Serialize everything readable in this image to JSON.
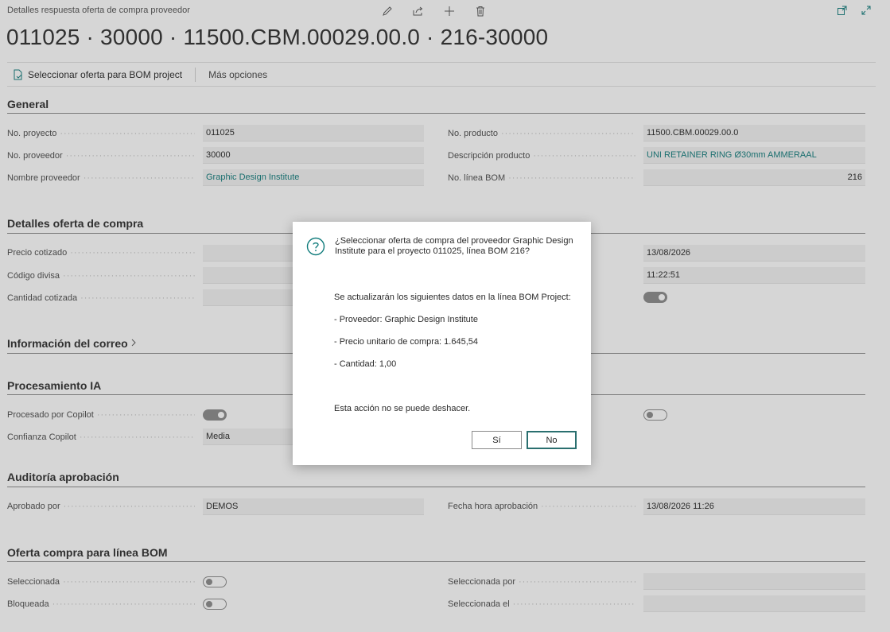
{
  "header": {
    "breadcrumb": "Detalles respuesta oferta de compra proveedor",
    "title": "011025 · 30000 · 11500.CBM.00029.00.0 · 216-30000"
  },
  "actions": {
    "select_offer": "Seleccionar oferta para BOM project",
    "more_options": "Más opciones"
  },
  "general": {
    "title": "General",
    "project_no_label": "No. proyecto",
    "project_no": "011025",
    "vendor_no_label": "No. proveedor",
    "vendor_no": "30000",
    "vendor_name_label": "Nombre proveedor",
    "vendor_name": "Graphic Design Institute",
    "product_no_label": "No. producto",
    "product_no": "11500.CBM.00029.00.0",
    "product_desc_label": "Descripción producto",
    "product_desc": "UNI RETAINER RING Ø30mm AMMERAAL",
    "bom_line_label": "No. línea BOM",
    "bom_line": "216"
  },
  "offer_details": {
    "title": "Detalles oferta de compra",
    "price_label": "Precio cotizado",
    "currency_label": "Código divisa",
    "qty_label": "Cantidad cotizada",
    "date_value": "13/08/2026",
    "time_value": "11:22:51",
    "right_toggle_on": true
  },
  "mail_info": {
    "title": "Información del correo"
  },
  "ai": {
    "title": "Procesamiento IA",
    "processed_label": "Procesado por Copilot",
    "processed_on": true,
    "confidence_label": "Confianza Copilot",
    "confidence": "Media",
    "right_toggle_on": false
  },
  "audit": {
    "title": "Auditoría aprobación",
    "approved_by_label": "Aprobado por",
    "approved_by": "DEMOS",
    "approved_at_label": "Fecha hora aprobación",
    "approved_at": "13/08/2026 11:26"
  },
  "bom_offer": {
    "title": "Oferta compra para línea BOM",
    "selected_label": "Seleccionada",
    "selected_on": false,
    "locked_label": "Bloqueada",
    "locked_on": false,
    "selected_by_label": "Seleccionada por",
    "selected_at_label": "Seleccionada el"
  },
  "dialog": {
    "question": "¿Seleccionar oferta de compra del proveedor Graphic Design Institute para el proyecto 011025, línea BOM 216?",
    "intro": "Se actualizarán los siguientes datos en la línea BOM Project:",
    "line_vendor": "- Proveedor: Graphic Design Institute",
    "line_price": "- Precio unitario de compra: 1.645,54",
    "line_qty": "- Cantidad: 1,00",
    "warning": "Esta acción no se puede deshacer.",
    "yes_label": "Sí",
    "no_label": "No"
  },
  "colors": {
    "accent": "#0f7b7b",
    "button_focus": "#2a6f6f"
  }
}
